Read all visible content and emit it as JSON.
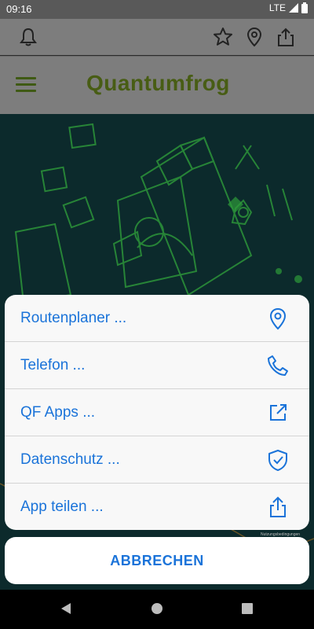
{
  "status": {
    "time": "09:16",
    "network": "LTE"
  },
  "header": {
    "logo": "Quantumfrog"
  },
  "hero": {
    "watermark": "Nutzungsbedingungen"
  },
  "menu": {
    "items": [
      {
        "label": "Routenplaner ...",
        "icon": "location-pin-icon"
      },
      {
        "label": "Telefon ...",
        "icon": "phone-icon"
      },
      {
        "label": "QF Apps ...",
        "icon": "external-link-icon"
      },
      {
        "label": "Datenschutz ...",
        "icon": "shield-check-icon"
      },
      {
        "label": "App teilen ...",
        "icon": "share-icon"
      }
    ],
    "cancel": "ABBRECHEN"
  },
  "colors": {
    "accent": "#1a73d9",
    "brand": "#485d14",
    "hero_bg": "#0c2a2c"
  }
}
